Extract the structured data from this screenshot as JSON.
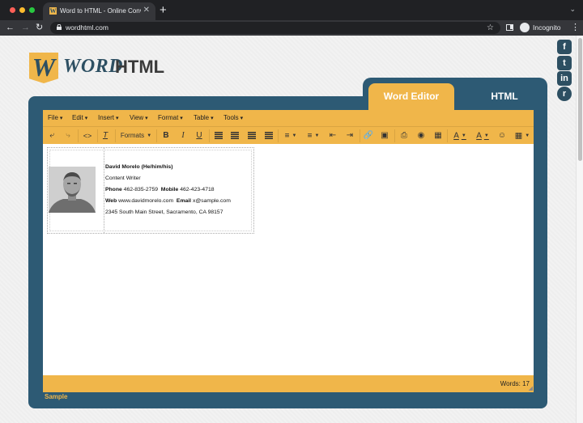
{
  "browser": {
    "tab_title": "Word to HTML - Online Conver",
    "url": "wordhtml.com",
    "incognito_label": "Incognito",
    "new_tab_label": "+",
    "close_label": "✕"
  },
  "logo": {
    "w_letter": "W",
    "word": "WORD",
    "html": "HTML"
  },
  "social": [
    {
      "icon": "facebook-icon",
      "glyph": "f"
    },
    {
      "icon": "twitter-icon",
      "glyph": "t"
    },
    {
      "icon": "linkedin-icon",
      "glyph": "in"
    },
    {
      "icon": "reddit-icon",
      "glyph": "r"
    }
  ],
  "tabs": {
    "word_editor": "Word Editor",
    "html": "HTML"
  },
  "menu": [
    "File",
    "Edit",
    "Insert",
    "View",
    "Format",
    "Table",
    "Tools"
  ],
  "toolbar": {
    "formats_label": "Formats"
  },
  "signature": {
    "name": "David Morelo (He/him/his)",
    "title": "Content Writer",
    "phone_label": "Phone",
    "phone": "462-835-2759",
    "mobile_label": "Mobile",
    "mobile": "462-423-4718",
    "web_label": "Web",
    "web": "www.davidmorelo.com",
    "email_label": "Email",
    "email": "x@sample.com",
    "address": "2345 South Main Street, Sacramento, CA 98157"
  },
  "status": {
    "words": "Words: 17"
  },
  "sample_label": "Sample",
  "colors": {
    "accent": "#f0b64a",
    "brand": "#2d5a74"
  }
}
